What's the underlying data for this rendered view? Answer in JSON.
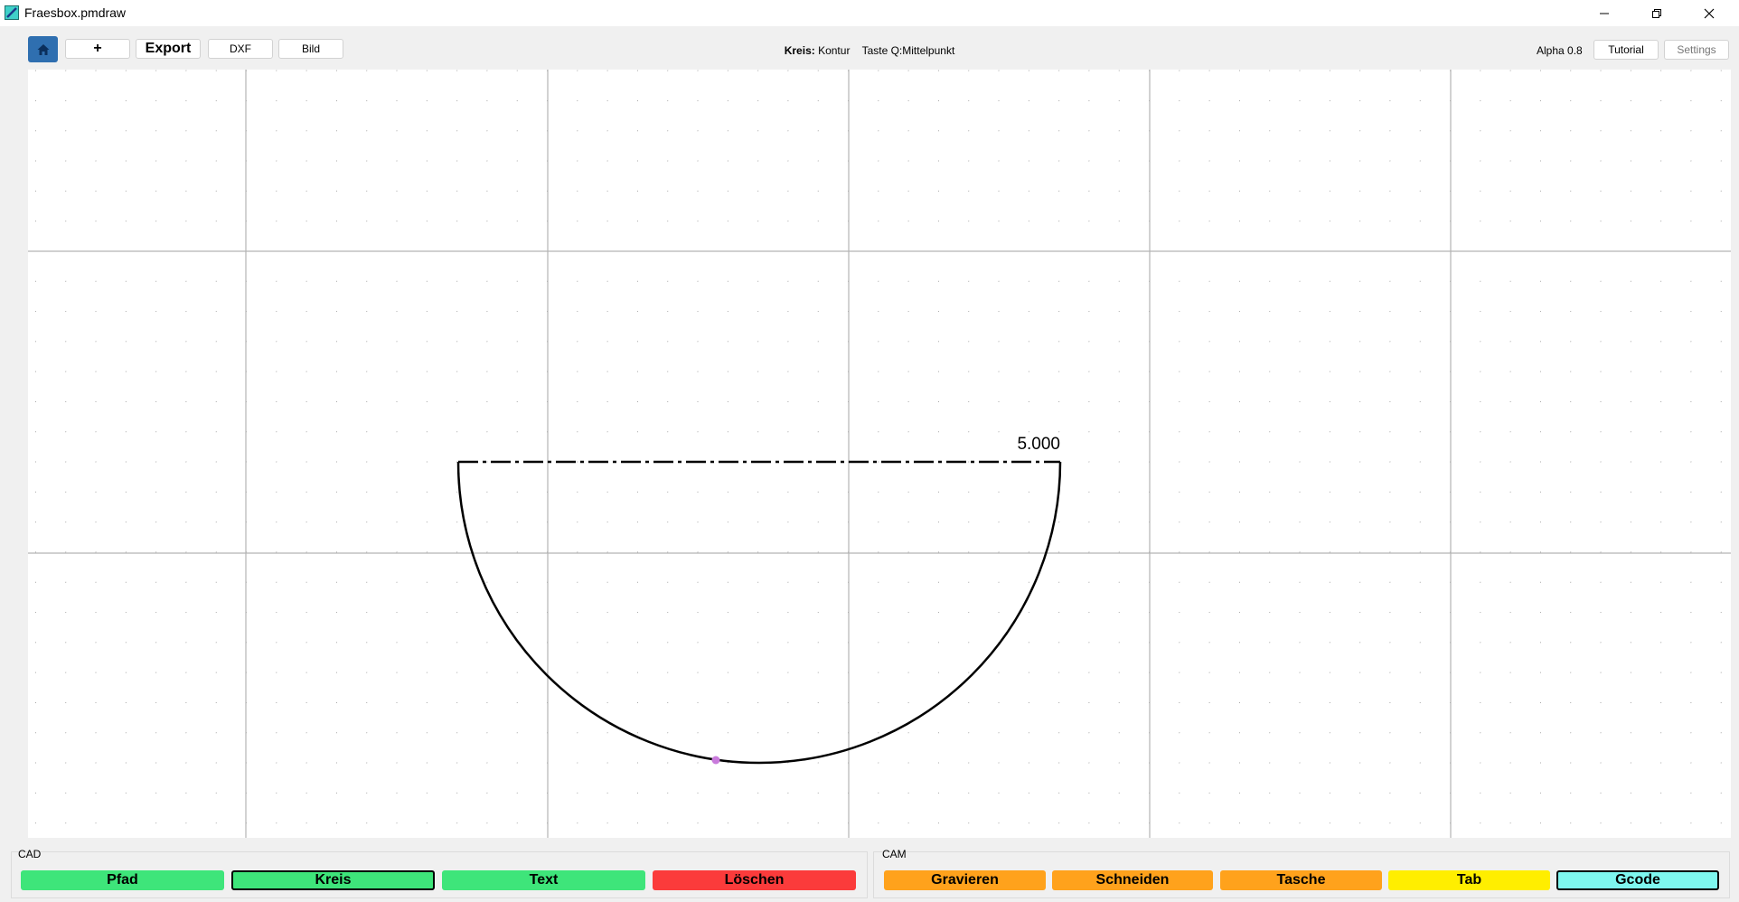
{
  "window": {
    "title": "Fraesbox.pmdraw"
  },
  "toolbar": {
    "add_label": "+",
    "export_label": "Export",
    "dxf_label": "DXF",
    "image_label": "Bild",
    "status_tool": "Kreis:",
    "status_mode": "Kontur",
    "status_hint": "Taste Q:Mittelpunkt",
    "version": "Alpha 0.8",
    "tutorial_label": "Tutorial",
    "settings_label": "Settings"
  },
  "canvas": {
    "dimension_label": "5.000"
  },
  "cad": {
    "label": "CAD",
    "buttons": [
      "Pfad",
      "Kreis",
      "Text",
      "Löschen"
    ]
  },
  "cam": {
    "label": "CAM",
    "buttons": [
      "Gravieren",
      "Schneiden",
      "Tasche",
      "Tab",
      "Gcode"
    ]
  },
  "icons": {
    "app": "app-logo-icon",
    "home": "home-icon",
    "minimize": "minimize-icon",
    "restore": "restore-icon",
    "close": "close-icon"
  },
  "colors": {
    "cad_button": "#3ee57a",
    "delete_button": "#fb3b3b",
    "cam_button": "#ffa21c",
    "tab_button": "#ffee00",
    "gcode_button": "#7ef7ef",
    "home_button": "#2f6fb0",
    "selection_point": "#c97bdc"
  }
}
